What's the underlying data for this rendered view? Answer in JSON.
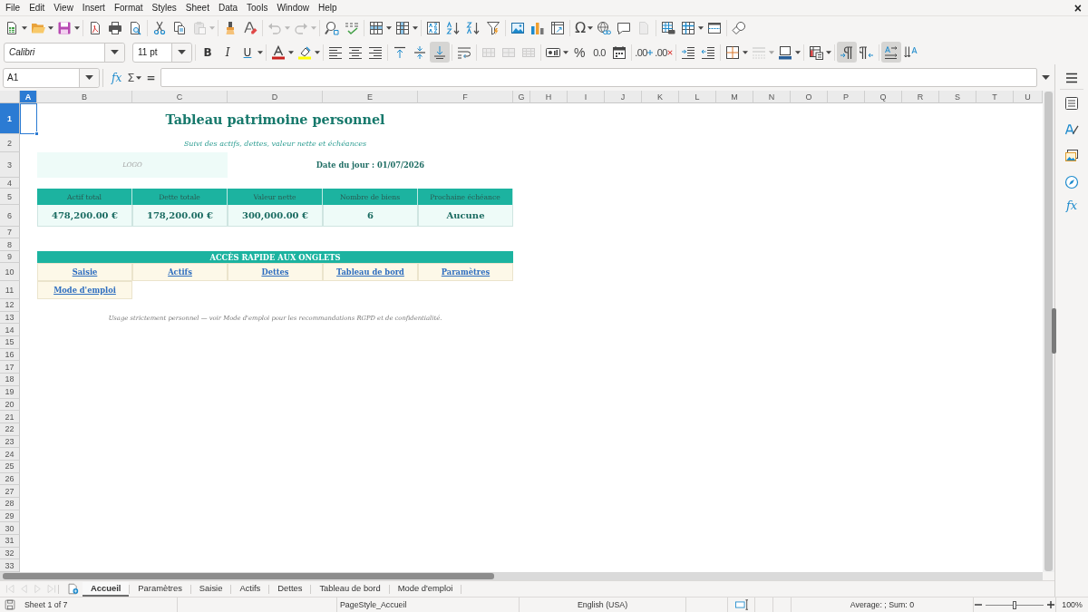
{
  "menu_bar": {
    "items": [
      "File",
      "Edit",
      "View",
      "Insert",
      "Format",
      "Styles",
      "Sheet",
      "Data",
      "Tools",
      "Window",
      "Help"
    ],
    "close": "×"
  },
  "standard_toolbar": {
    "special_character": "Ω",
    "disabled": {
      "paste": true,
      "undo": true,
      "redo": true,
      "headers_footers": true
    }
  },
  "formatting_toolbar": {
    "font_name": "Calibri",
    "font_size": "11 pt",
    "text_styles": [
      {
        "kind": "bold",
        "label": "B",
        "on": false
      },
      {
        "kind": "italic",
        "label": "I",
        "on": false
      },
      {
        "kind": "underline",
        "label": "U",
        "on": false
      }
    ],
    "horizontal_align": [
      {
        "kind": "left",
        "selected": false
      },
      {
        "kind": "center",
        "selected": false
      },
      {
        "kind": "right",
        "selected": false
      }
    ],
    "vertical_align": [
      {
        "kind": "top",
        "selected": false
      },
      {
        "kind": "center",
        "selected": false
      },
      {
        "kind": "bottom",
        "selected": true
      }
    ],
    "merge_disabled": true,
    "percent": "%",
    "number_format": "0.0",
    "add_decimal": ".00",
    "delete_decimal": ".00",
    "border_style_disabled": true,
    "paragraph_direction": [
      {
        "kind": "left-to-right",
        "selected": true
      },
      {
        "kind": "right-to-left",
        "selected": false
      }
    ],
    "text_direction": [
      {
        "kind": "horizontal",
        "selected": true
      },
      {
        "kind": "vertical",
        "selected": false
      }
    ]
  },
  "formula_bar": {
    "name_box": "A1",
    "function_wizard": "fx",
    "sum": "Σ",
    "formula": "="
  },
  "sidebar": {
    "functions": "fx"
  },
  "columns": [
    {
      "label": "A",
      "selected": true
    },
    {
      "label": "B",
      "selected": false
    },
    {
      "label": "C",
      "selected": false
    },
    {
      "label": "D",
      "selected": false
    },
    {
      "label": "E",
      "selected": false
    },
    {
      "label": "F",
      "selected": false
    },
    {
      "label": "G",
      "selected": false
    },
    {
      "label": "H",
      "selected": false
    },
    {
      "label": "I",
      "selected": false
    },
    {
      "label": "J",
      "selected": false
    },
    {
      "label": "K",
      "selected": false
    },
    {
      "label": "L",
      "selected": false
    },
    {
      "label": "M",
      "selected": false
    },
    {
      "label": "N",
      "selected": false
    },
    {
      "label": "O",
      "selected": false
    },
    {
      "label": "P",
      "selected": false
    },
    {
      "label": "Q",
      "selected": false
    },
    {
      "label": "R",
      "selected": false
    },
    {
      "label": "S",
      "selected": false
    },
    {
      "label": "T",
      "selected": false
    },
    {
      "label": "U",
      "selected": false
    }
  ],
  "rows": [
    {
      "label": "1",
      "selected": true
    },
    {
      "label": "2",
      "selected": false
    },
    {
      "label": "3",
      "selected": false
    },
    {
      "label": "4",
      "selected": false
    },
    {
      "label": "5",
      "selected": false
    },
    {
      "label": "6",
      "selected": false
    },
    {
      "label": "7",
      "selected": false
    },
    {
      "label": "8",
      "selected": false
    },
    {
      "label": "9",
      "selected": false
    },
    {
      "label": "10",
      "selected": false
    },
    {
      "label": "11",
      "selected": false
    },
    {
      "label": "12",
      "selected": false
    },
    {
      "label": "13",
      "selected": false
    },
    {
      "label": "14",
      "selected": false
    },
    {
      "label": "15",
      "selected": false
    },
    {
      "label": "16",
      "selected": false
    },
    {
      "label": "17",
      "selected": false
    },
    {
      "label": "18",
      "selected": false
    },
    {
      "label": "19",
      "selected": false
    },
    {
      "label": "20",
      "selected": false
    },
    {
      "label": "21",
      "selected": false
    },
    {
      "label": "22",
      "selected": false
    },
    {
      "label": "23",
      "selected": false
    },
    {
      "label": "24",
      "selected": false
    },
    {
      "label": "25",
      "selected": false
    },
    {
      "label": "26",
      "selected": false
    },
    {
      "label": "27",
      "selected": false
    },
    {
      "label": "28",
      "selected": false
    },
    {
      "label": "29",
      "selected": false
    },
    {
      "label": "30",
      "selected": false
    },
    {
      "label": "31",
      "selected": false
    },
    {
      "label": "32",
      "selected": false
    },
    {
      "label": "33",
      "selected": false
    }
  ],
  "sheet": {
    "title": "Tableau patrimoine personnel",
    "subtitle": "Suivi des actifs, dettes, valeur nette et échéances",
    "logo": "LOGO",
    "date": "Date du jour : 01/07/2026",
    "summary": [
      {
        "header": "Actif total",
        "value": "478,200.00 €"
      },
      {
        "header": "Dette totale",
        "value": "178,200.00 €"
      },
      {
        "header": "Valeur nette",
        "value": "300,000.00 €"
      },
      {
        "header": "Nombre de biens",
        "value": "6"
      },
      {
        "header": "Prochaine échéance",
        "value": "Aucune"
      }
    ],
    "quick_access": {
      "heading": "ACCÈS RAPIDE AUX ONGLETS",
      "links": [
        "Saisie",
        "Actifs",
        "Dettes",
        "Tableau de bord",
        "Paramètres",
        "Mode d'emploi"
      ]
    },
    "note": "Usage strictement personnel — voir Mode d'emploi pour les recommandations RGPD et de confidentialité."
  },
  "sheet_tabs_bar": {
    "navigation_disabled": true,
    "tabs": [
      {
        "label": "Accueil",
        "selected": true
      },
      {
        "label": "Paramètres",
        "selected": false
      },
      {
        "label": "Saisie",
        "selected": false
      },
      {
        "label": "Actifs",
        "selected": false
      },
      {
        "label": "Dettes",
        "selected": false
      },
      {
        "label": "Tableau de bord",
        "selected": false
      },
      {
        "label": "Mode d'emploi",
        "selected": false
      }
    ]
  },
  "status_bar": {
    "sheet": "Sheet 1 of 7",
    "page_style": "PageStyle_Accueil",
    "language": "English (USA)",
    "selection": "Average: ; Sum: 0",
    "zoom_slider": {
      "level": 0.5
    },
    "zoom": "100%"
  }
}
